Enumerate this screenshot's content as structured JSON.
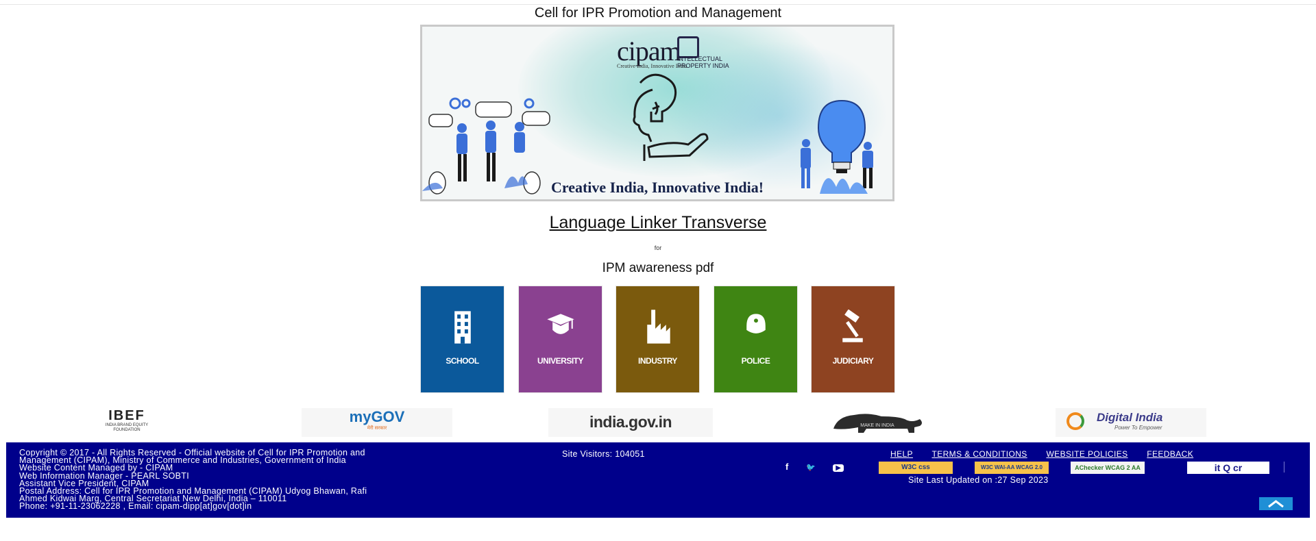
{
  "header": {
    "title": "Cell for IPR Promotion and Management"
  },
  "banner": {
    "logo_cipam": "cipam",
    "logo_cipam_sub": "Creative India, Innovative India",
    "logo_ipi": "INTELLECTUAL PROPERTY INDIA",
    "tagline": "Creative India, Innovative India!"
  },
  "main": {
    "link_title": "Language Linker Transverse",
    "for_text": "for",
    "subheading": "IPM awareness pdf"
  },
  "tiles": [
    {
      "label": "SCHOOL",
      "color": "#0b599b",
      "icon": "building-icon"
    },
    {
      "label": "UNIVERSITY",
      "color": "#8a4190",
      "icon": "graduation-cap-icon"
    },
    {
      "label": "INDUSTRY",
      "color": "#7b5a0d",
      "icon": "factory-icon"
    },
    {
      "label": "POLICE",
      "color": "#3f8513",
      "icon": "police-helmet-icon"
    },
    {
      "label": "JUDICIARY",
      "color": "#8e4321",
      "icon": "gavel-icon"
    }
  ],
  "partners": [
    {
      "name": "IBEF",
      "sub": "INDIA BRAND EQUITY FOUNDATION"
    },
    {
      "name": "myGOV",
      "sub": "मेरी सरकार"
    },
    {
      "name": "india.gov.in"
    },
    {
      "name": "MAKE IN INDIA"
    },
    {
      "name": "Digital India",
      "sub": "Power To Empower"
    }
  ],
  "footer": {
    "copyright_lines": [
      "Copyright © 2017 - All Rights Reserved - Official website of Cell for IPR Promotion and",
      "Management (CIPAM), Ministry of Commerce and Industries, Government of India",
      "Website Content Managed by - CIPAM",
      "Web Information Manager - PEARL SOBTI",
      "Assistant Vice President, CIPAM",
      "Postal Address: Cell for IPR Promotion and Management (CIPAM) Udyog Bhawan, Rafi",
      "Ahmed Kidwai Marg, Central Secretariat New Delhi, India – 110011",
      "Phone: +91-11-23062228 , Email: cipam-dipp[at]gov[dot]in"
    ],
    "visitors": "Site Visitors: 104051",
    "links": [
      "HELP",
      "TERMS & CONDITIONS",
      "WEBSITE POLICIES",
      "FEEDBACK"
    ],
    "social": [
      {
        "glyph": "f",
        "icon": "facebook-icon"
      },
      {
        "glyph": "🐦",
        "icon": "twitter-icon"
      },
      {
        "glyph": "▶",
        "icon": "youtube-icon"
      }
    ],
    "badges": [
      {
        "label": "W3C css",
        "icon": "w3c-css-badge"
      },
      {
        "label": "W3C WAI-AA WCAG 2.0",
        "icon": "w3c-wai-badge"
      },
      {
        "label": "AChecker WCAG 2 AA",
        "icon": "achecker-badge"
      },
      {
        "label": "it Q cr",
        "icon": "itqcr-badge"
      }
    ],
    "updated": "Site Last Updated on :27 Sep 2023"
  }
}
